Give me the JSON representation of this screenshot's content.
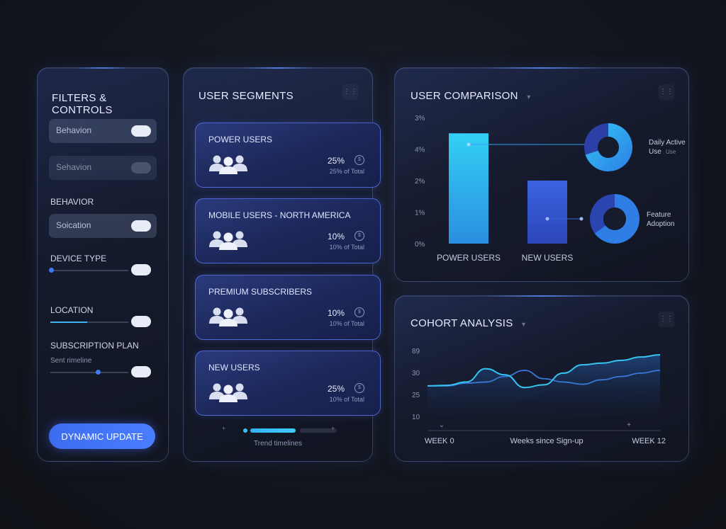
{
  "filters": {
    "title": "FILTERS & CONTROLS",
    "chips": [
      "Behavion",
      "Sehavion"
    ],
    "behavior_label": "BEHAVIOR",
    "behavior_chip": "Soication",
    "device_label": "DEVICE TYPE",
    "location_label": "LOCATION",
    "subscription_label": "SUBSCRIPTION PLAN",
    "timeline_label": "Sent rimeline",
    "button": "DYNAMIC UPDATE"
  },
  "segments": {
    "title": "USER SEGMENTS",
    "items": [
      {
        "name": "POWER USERS",
        "pct": "25%",
        "sub": "25% of Total"
      },
      {
        "name": "MOBILE USERS - NORTH AMERICA",
        "pct": "10%",
        "sub": "10% of Total"
      },
      {
        "name": "PREMIUM SUBSCRIBERS",
        "pct": "10%",
        "sub": "10% of Total"
      },
      {
        "name": "NEW USERS",
        "pct": "25%",
        "sub": "10% of Total"
      }
    ],
    "footer": "Trend timelines"
  },
  "comparison": {
    "title": "USER COMPARISON",
    "donut1_label": [
      "Daily Active",
      "Use"
    ],
    "donut1_sub": "Use",
    "donut2_label": [
      "Feature",
      "Adoption"
    ]
  },
  "cohort": {
    "title": "COHORT ANALYSIS"
  },
  "colors": {
    "accent": "#3d6cf0",
    "cyan": "#35c6f2",
    "bar2": "#3a5bd6"
  },
  "chart_data": [
    {
      "type": "bar",
      "title": "USER COMPARISON",
      "categories": [
        "POWER USERS",
        "NEW USERS"
      ],
      "values": [
        3.5,
        2.0
      ],
      "ytick_labels": [
        "0%",
        "1%",
        "2%",
        "4%",
        "3%"
      ],
      "ylim": [
        0,
        4
      ]
    },
    {
      "type": "pie",
      "labels": [
        "Daily Active Use",
        ""
      ],
      "values": [
        70,
        30
      ]
    },
    {
      "type": "pie",
      "labels": [
        "Feature Adoption",
        ""
      ],
      "values": [
        65,
        35
      ]
    },
    {
      "type": "line",
      "title": "COHORT ANALYSIS",
      "xlabel": "Weeks since Sign-up",
      "x_tick_labels": [
        "WEEK 0",
        "WEEK 12"
      ],
      "ytick_labels": [
        "10",
        "25",
        "30",
        "89"
      ],
      "x": [
        0,
        1,
        2,
        3,
        4,
        5,
        6,
        7,
        8,
        9,
        10,
        11,
        12
      ],
      "series": [
        {
          "values": [
            0.55,
            0.56,
            0.62,
            0.86,
            0.75,
            0.52,
            0.57,
            0.78,
            0.93,
            0.96,
            1.01,
            1.07,
            1.11
          ]
        },
        {
          "values": [
            0.55,
            0.55,
            0.6,
            0.62,
            0.72,
            0.83,
            0.68,
            0.62,
            0.58,
            0.66,
            0.72,
            0.78,
            0.83
          ]
        }
      ]
    }
  ]
}
